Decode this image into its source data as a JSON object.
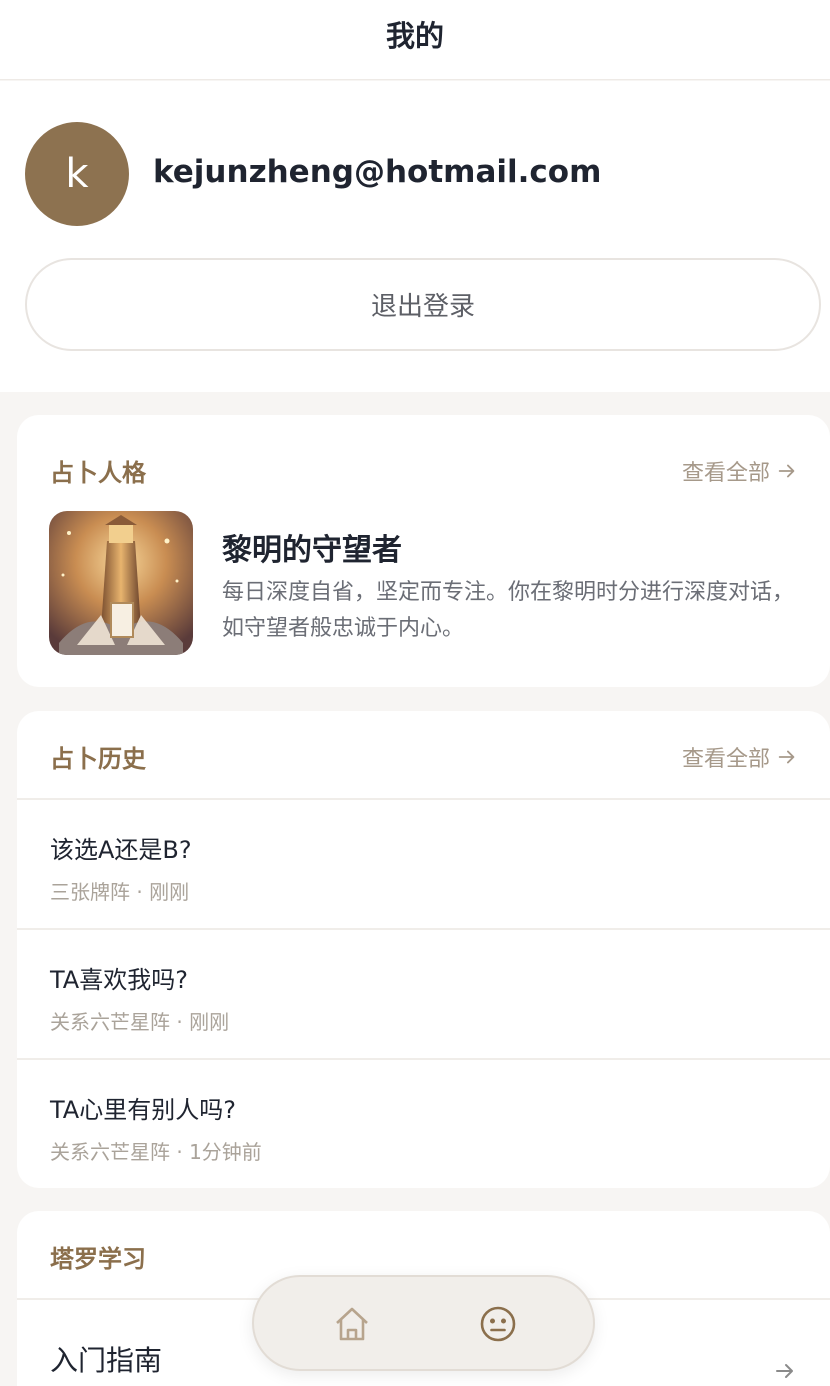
{
  "header": {
    "title": "我的"
  },
  "profile": {
    "avatar_letter": "k",
    "email": "kejunzheng@hotmail.com",
    "logout_label": "退出登录"
  },
  "persona": {
    "section_title": "占卜人格",
    "view_all": "查看全部",
    "name": "黎明的守望者",
    "description": "每日深度自省，坚定而专注。你在黎明时分进行深度对话，如守望者般忠诚于内心。"
  },
  "history": {
    "section_title": "占卜历史",
    "view_all": "查看全部",
    "items": [
      {
        "question": "该选A还是B?",
        "meta": "三张牌阵 · 刚刚"
      },
      {
        "question": "TA喜欢我吗?",
        "meta": "关系六芒星阵 · 刚刚"
      },
      {
        "question": "TA心里有别人吗?",
        "meta": "关系六芒星阵 · 1分钟前"
      }
    ]
  },
  "learn": {
    "section_title": "塔罗学习",
    "items": [
      {
        "label": "入门指南"
      }
    ]
  },
  "tabbar": {
    "icons": [
      "home-icon",
      "face-icon"
    ]
  },
  "colors": {
    "accent": "#8b6f4c",
    "avatar_bg": "#8d7250"
  }
}
